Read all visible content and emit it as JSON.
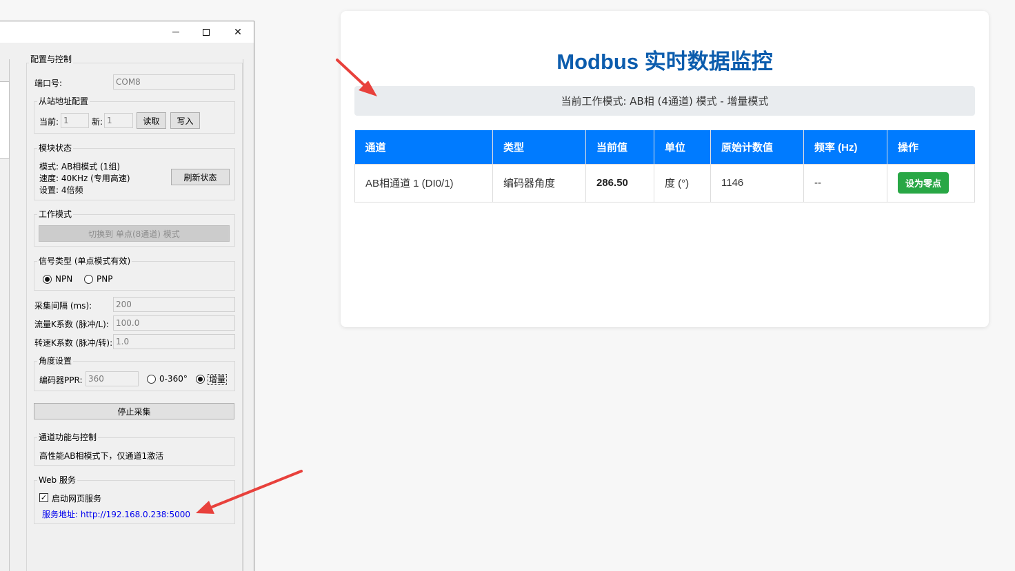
{
  "window": {
    "controls": {
      "minimize": "—",
      "maximize": "□",
      "close": "✕"
    },
    "config_group": "配置与控制",
    "port": {
      "label": "端口号:",
      "value": "COM8"
    },
    "slave": {
      "group": "从站地址配置",
      "current_label": "当前:",
      "current_value": "1",
      "new_label": "新:",
      "new_value": "1",
      "read_button": "读取",
      "write_button": "写入"
    },
    "module_status": {
      "group": "模块状态",
      "lines": [
        "模式: AB相模式 (1组)",
        "速度: 40KHz (专用高速)",
        "设置: 4倍频"
      ],
      "refresh_button": "刷新状态"
    },
    "work_mode": {
      "group": "工作模式",
      "switch_button": "切换到 单点(8通道) 模式"
    },
    "signal_type": {
      "group": "信号类型 (单点模式有效)",
      "options": [
        "NPN",
        "PNP"
      ],
      "selected": "NPN"
    },
    "interval": {
      "label": "采集间隔 (ms):",
      "value": "200"
    },
    "flow_k": {
      "label": "流量K系数 (脉冲/L):",
      "value": "100.0"
    },
    "speed_k": {
      "label": "转速K系数 (脉冲/转):",
      "value": "1.0"
    },
    "angle": {
      "group": "角度设置",
      "ppr_label": "编码器PPR:",
      "ppr_value": "360",
      "options": [
        "0-360°",
        "增量"
      ],
      "selected": "增量"
    },
    "stop_button": "停止采集",
    "channel_func": {
      "group": "通道功能与控制",
      "text": "高性能AB相模式下，仅通道1激活"
    },
    "web_service": {
      "group": "Web 服务",
      "enable_label": "启动网页服务",
      "enabled": true,
      "check_mark": "✓",
      "address_label": "服务地址: http://192.168.0.238:5000"
    }
  },
  "web": {
    "title": "Modbus 实时数据监控",
    "mode_text": "当前工作模式: AB相 (4通道) 模式 - 增量模式",
    "table": {
      "headers": [
        "通道",
        "类型",
        "当前值",
        "单位",
        "原始计数值",
        "频率 (Hz)",
        "操作"
      ],
      "rows": [
        {
          "channel": "AB相通道 1 (DI0/1)",
          "type": "编码器角度",
          "value": "286.50",
          "unit": "度 (°)",
          "raw": "1146",
          "freq": "--",
          "action": "设为零点"
        }
      ]
    }
  },
  "colors": {
    "title": "#0b5cad",
    "table_header": "#007bff",
    "zero_button": "#28a745",
    "arrow": "#e8413c"
  }
}
